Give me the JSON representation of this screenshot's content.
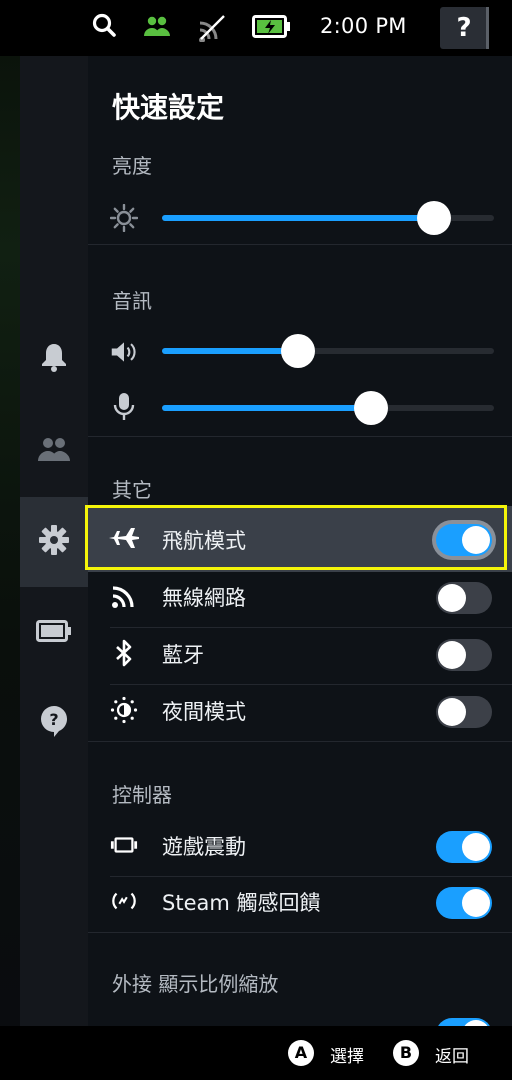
{
  "status_bar": {
    "time": "2:00 PM",
    "help_label": "?",
    "icons": [
      "search-icon",
      "friends-icon",
      "wifi-off-icon",
      "battery-charging-icon"
    ],
    "friends_color": "#59bf40",
    "battery_color": "#59bf40"
  },
  "sidebar": {
    "items": [
      {
        "icon": "bell-icon",
        "active": false
      },
      {
        "icon": "friends-icon",
        "active": false
      },
      {
        "icon": "gear-icon",
        "active": true
      },
      {
        "icon": "battery-icon",
        "active": false
      },
      {
        "icon": "help-icon",
        "active": false
      }
    ]
  },
  "panel": {
    "title": "快速設定",
    "brightness": {
      "label": "亮度",
      "value": 0.82
    },
    "audio": {
      "label": "音訊",
      "volume": 0.41,
      "mic": 0.63
    },
    "other": {
      "label": "其它",
      "items": [
        {
          "label": "飛航模式",
          "icon": "airplane-icon",
          "on": true,
          "focused": true
        },
        {
          "label": "無線網路",
          "icon": "wifi-icon",
          "on": false
        },
        {
          "label": "藍牙",
          "icon": "bluetooth-icon",
          "on": false
        },
        {
          "label": "夜間模式",
          "icon": "night-mode-icon",
          "on": false
        }
      ]
    },
    "controller": {
      "label": "控制器",
      "items": [
        {
          "label": "遊戲震動",
          "icon": "rumble-icon",
          "on": true
        },
        {
          "label": "Steam 觸感回饋",
          "icon": "haptics-icon",
          "on": true
        }
      ]
    },
    "external_display": {
      "label": "外接 顯示比例縮放"
    }
  },
  "footer": {
    "a_button": "A",
    "a_label": "選擇",
    "b_button": "B",
    "b_label": "返回"
  },
  "colors": {
    "accent": "#1a9fff",
    "focus_outline": "#f5f50a"
  }
}
